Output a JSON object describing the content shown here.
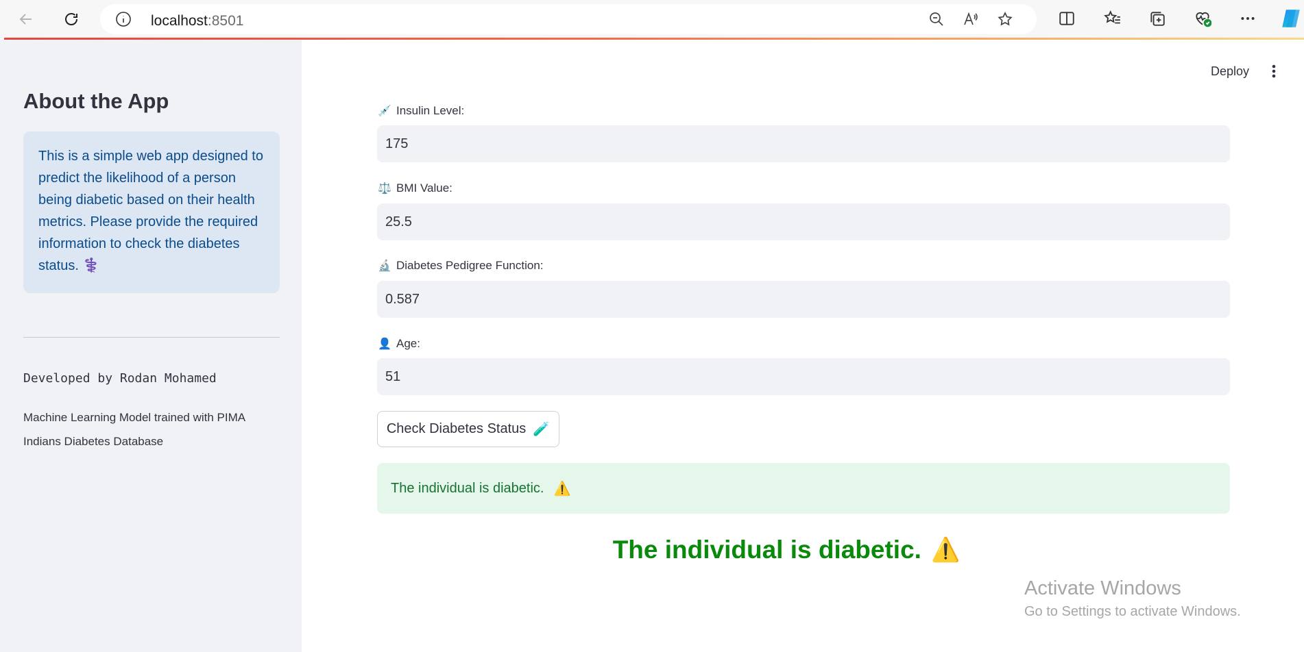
{
  "browser": {
    "url_host": "localhost",
    "url_port": ":8501"
  },
  "sidebar": {
    "title": "About the App",
    "info_text": "This is a simple web app designed to predict the likelihood of a person being diabetic based on their health metrics. Please provide the required information to check the diabetes status. ⚕️",
    "developer": "Developed by Rodan Mohamed",
    "model_note": "Machine Learning Model trained with PIMA Indians Diabetes Database"
  },
  "header": {
    "deploy_label": "Deploy"
  },
  "form": {
    "fields": [
      {
        "emoji": "💉",
        "label": "Insulin Level:",
        "value": "175"
      },
      {
        "emoji": "⚖️",
        "label": "BMI Value:",
        "value": "25.5"
      },
      {
        "emoji": "🔬",
        "label": "Diabetes Pedigree Function:",
        "value": "0.587"
      },
      {
        "emoji": "👤",
        "label": "Age:",
        "value": "51"
      }
    ],
    "submit_label": "Check Diabetes Status",
    "submit_emoji": "🧪"
  },
  "result": {
    "alert_text": "The individual is diabetic.",
    "alert_emoji": "⚠️",
    "headline": "The individual is diabetic.",
    "headline_emoji": "⚠️"
  },
  "watermark": {
    "line1": "Activate Windows",
    "line2": "Go to Settings to activate Windows."
  },
  "colors": {
    "sidebar_bg": "#f0f2f6",
    "info_bg": "#dde7f3",
    "success_bg": "#e5f6ea",
    "success_text": "#177233",
    "headline_green": "#0a8a0a"
  }
}
